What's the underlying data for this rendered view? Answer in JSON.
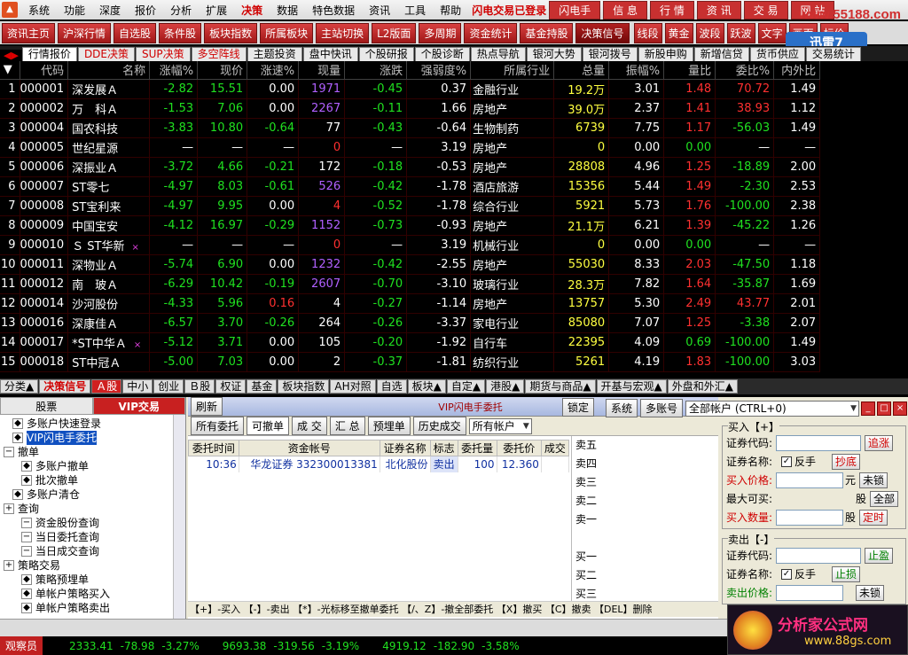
{
  "menubar": {
    "items": [
      "系统",
      "功能",
      "深度",
      "报价",
      "分析",
      "扩展",
      "决策",
      "数据",
      "特色数据",
      "资讯",
      "工具",
      "帮助"
    ],
    "active_index": 6,
    "status": "闪电交易已登录",
    "right_buttons": [
      "闪电手",
      "信 息",
      "行 情",
      "资 讯",
      "交 易",
      "网 站"
    ]
  },
  "watermark": "www.55188.com",
  "toolbar": {
    "buttons": [
      "资讯主页",
      "沪深行情",
      "自选股",
      "条件股",
      "板块指数",
      "所属板块",
      "主站切换",
      "L2版面",
      "多周期",
      "资金统计",
      "基金持股",
      "决策信号"
    ],
    "right_buttons": [
      "线段",
      "黄金",
      "波段",
      "跃波",
      "文字",
      "画面",
      "标价"
    ]
  },
  "xunlei": "迅雷7",
  "tabs": {
    "items": [
      "行情报价",
      "DDE决策",
      "SUP决策",
      "多空阵线",
      "主题投资",
      "盘中快讯",
      "个股研报",
      "个股诊断",
      "热点导航",
      "银河大势",
      "银河拨号",
      "新股申购",
      "新增信贷",
      "货币供应",
      "交易统计"
    ],
    "selected": 0,
    "red": [
      1,
      2,
      3
    ]
  },
  "grid": {
    "headers": [
      "",
      "代码",
      "名称",
      "涨幅%",
      "现价",
      "涨速%",
      "现量",
      "涨跌",
      "强弱度%",
      "所属行业",
      "总量",
      "振幅%",
      "量比",
      "委比%",
      "内外比"
    ],
    "rows": [
      {
        "n": "1",
        "code": "000001",
        "name": "深发展Ａ",
        "mark": "",
        "chg": "-2.82",
        "price": "15.51",
        "speed": "0.00",
        "vol": "1971",
        "diff": "-0.45",
        "str": "0.37",
        "ind": "金融行业",
        "total": "19.2万",
        "amp": "3.01",
        "vr": "1.48",
        "wb": "70.72",
        "io": "1.49",
        "c": {
          "chg": "g",
          "price": "g",
          "speed": "w",
          "vol": "p",
          "diff": "g",
          "total": "y",
          "vr": "r",
          "wb": "r"
        }
      },
      {
        "n": "2",
        "code": "000002",
        "name": "万　科Ａ",
        "mark": "",
        "chg": "-1.53",
        "price": "7.06",
        "speed": "0.00",
        "vol": "2267",
        "diff": "-0.11",
        "str": "1.66",
        "ind": "房地产",
        "total": "39.0万",
        "amp": "2.37",
        "vr": "1.41",
        "wb": "38.93",
        "io": "1.12",
        "c": {
          "chg": "g",
          "price": "g",
          "speed": "w",
          "vol": "p",
          "diff": "g",
          "total": "y",
          "vr": "r",
          "wb": "r"
        }
      },
      {
        "n": "3",
        "code": "000004",
        "name": "国农科技",
        "mark": "",
        "chg": "-3.83",
        "price": "10.80",
        "speed": "-0.64",
        "vol": "77",
        "diff": "-0.43",
        "str": "-0.64",
        "ind": "生物制药",
        "total": "6739",
        "amp": "7.75",
        "vr": "1.17",
        "wb": "-56.03",
        "io": "1.49",
        "c": {
          "chg": "g",
          "price": "g",
          "speed": "g",
          "vol": "w",
          "diff": "g",
          "total": "y",
          "vr": "r",
          "wb": "g"
        }
      },
      {
        "n": "4",
        "code": "000005",
        "name": "世纪星源",
        "mark": "",
        "chg": "—",
        "price": "—",
        "speed": "—",
        "vol": "0",
        "diff": "—",
        "str": "3.19",
        "ind": "房地产",
        "total": "0",
        "amp": "0.00",
        "vr": "0.00",
        "wb": "—",
        "io": "—",
        "c": {
          "chg": "w",
          "price": "w",
          "speed": "w",
          "vol": "r",
          "diff": "w",
          "total": "y",
          "vr": "g",
          "wb": "w"
        }
      },
      {
        "n": "5",
        "code": "000006",
        "name": "深振业Ａ",
        "mark": "",
        "chg": "-3.72",
        "price": "4.66",
        "speed": "-0.21",
        "vol": "172",
        "diff": "-0.18",
        "str": "-0.53",
        "ind": "房地产",
        "total": "28808",
        "amp": "4.96",
        "vr": "1.25",
        "wb": "-18.89",
        "io": "2.00",
        "c": {
          "chg": "g",
          "price": "g",
          "speed": "g",
          "vol": "w",
          "diff": "g",
          "total": "y",
          "vr": "r",
          "wb": "g"
        }
      },
      {
        "n": "6",
        "code": "000007",
        "name": "ST零七",
        "mark": "",
        "chg": "-4.97",
        "price": "8.03",
        "speed": "-0.61",
        "vol": "526",
        "diff": "-0.42",
        "str": "-1.78",
        "ind": "酒店旅游",
        "total": "15356",
        "amp": "5.44",
        "vr": "1.49",
        "wb": "-2.30",
        "io": "2.53",
        "c": {
          "chg": "g",
          "price": "g",
          "speed": "g",
          "vol": "p",
          "diff": "g",
          "total": "y",
          "vr": "r",
          "wb": "g"
        }
      },
      {
        "n": "7",
        "code": "000008",
        "name": "ST宝利来",
        "mark": "",
        "chg": "-4.97",
        "price": "9.95",
        "speed": "0.00",
        "vol": "4",
        "diff": "-0.52",
        "str": "-1.78",
        "ind": "综合行业",
        "total": "5921",
        "amp": "5.73",
        "vr": "1.76",
        "wb": "-100.00",
        "io": "2.38",
        "c": {
          "chg": "g",
          "price": "g",
          "speed": "w",
          "vol": "r",
          "diff": "g",
          "total": "y",
          "vr": "r",
          "wb": "g"
        }
      },
      {
        "n": "8",
        "code": "000009",
        "name": "中国宝安",
        "mark": "",
        "chg": "-4.12",
        "price": "16.97",
        "speed": "-0.29",
        "vol": "1152",
        "diff": "-0.73",
        "str": "-0.93",
        "ind": "房地产",
        "total": "21.1万",
        "amp": "6.21",
        "vr": "1.39",
        "wb": "-45.22",
        "io": "1.26",
        "c": {
          "chg": "g",
          "price": "g",
          "speed": "g",
          "vol": "p",
          "diff": "g",
          "total": "y",
          "vr": "r",
          "wb": "g"
        }
      },
      {
        "n": "9",
        "code": "000010",
        "name": "Ｓ ST华新",
        "mark": "×",
        "chg": "—",
        "price": "—",
        "speed": "—",
        "vol": "0",
        "diff": "—",
        "str": "3.19",
        "ind": "机械行业",
        "total": "0",
        "amp": "0.00",
        "vr": "0.00",
        "wb": "—",
        "io": "—",
        "c": {
          "chg": "w",
          "price": "w",
          "speed": "w",
          "vol": "r",
          "diff": "w",
          "total": "y",
          "vr": "g",
          "wb": "w"
        }
      },
      {
        "n": "10",
        "code": "000011",
        "name": "深物业Ａ",
        "mark": "",
        "chg": "-5.74",
        "price": "6.90",
        "speed": "0.00",
        "vol": "1232",
        "diff": "-0.42",
        "str": "-2.55",
        "ind": "房地产",
        "total": "55030",
        "amp": "8.33",
        "vr": "2.03",
        "wb": "-47.50",
        "io": "1.18",
        "c": {
          "chg": "g",
          "price": "g",
          "speed": "w",
          "vol": "p",
          "diff": "g",
          "total": "y",
          "vr": "r",
          "wb": "g"
        }
      },
      {
        "n": "11",
        "code": "000012",
        "name": "南　玻Ａ",
        "mark": "",
        "chg": "-6.29",
        "price": "10.42",
        "speed": "-0.19",
        "vol": "2607",
        "diff": "-0.70",
        "str": "-3.10",
        "ind": "玻璃行业",
        "total": "28.3万",
        "amp": "7.82",
        "vr": "1.64",
        "wb": "-35.87",
        "io": "1.69",
        "c": {
          "chg": "g",
          "price": "g",
          "speed": "g",
          "vol": "p",
          "diff": "g",
          "total": "y",
          "vr": "r",
          "wb": "g"
        }
      },
      {
        "n": "12",
        "code": "000014",
        "name": "沙河股份",
        "mark": "",
        "chg": "-4.33",
        "price": "5.96",
        "speed": "0.16",
        "vol": "4",
        "diff": "-0.27",
        "str": "-1.14",
        "ind": "房地产",
        "total": "13757",
        "amp": "5.30",
        "vr": "2.49",
        "wb": "43.77",
        "io": "2.01",
        "c": {
          "chg": "g",
          "price": "g",
          "speed": "r",
          "vol": "w",
          "diff": "g",
          "total": "y",
          "vr": "r",
          "wb": "r"
        }
      },
      {
        "n": "13",
        "code": "000016",
        "name": "深康佳Ａ",
        "mark": "",
        "chg": "-6.57",
        "price": "3.70",
        "speed": "-0.26",
        "vol": "264",
        "diff": "-0.26",
        "str": "-3.37",
        "ind": "家电行业",
        "total": "85080",
        "amp": "7.07",
        "vr": "1.25",
        "wb": "-3.38",
        "io": "2.07",
        "c": {
          "chg": "g",
          "price": "g",
          "speed": "g",
          "vol": "w",
          "diff": "g",
          "total": "y",
          "vr": "r",
          "wb": "g"
        }
      },
      {
        "n": "14",
        "code": "000017",
        "name": "*ST中华Ａ",
        "mark": "×",
        "chg": "-5.12",
        "price": "3.71",
        "speed": "0.00",
        "vol": "105",
        "diff": "-0.20",
        "str": "-1.92",
        "ind": "自行车",
        "total": "22395",
        "amp": "4.09",
        "vr": "0.69",
        "wb": "-100.00",
        "io": "1.49",
        "c": {
          "chg": "g",
          "price": "g",
          "speed": "w",
          "vol": "w",
          "diff": "g",
          "total": "y",
          "vr": "g",
          "wb": "g"
        }
      },
      {
        "n": "15",
        "code": "000018",
        "name": "ST中冠Ａ",
        "mark": "",
        "chg": "-5.00",
        "price": "7.03",
        "speed": "0.00",
        "vol": "2",
        "diff": "-0.37",
        "str": "-1.81",
        "ind": "纺织行业",
        "total": "5261",
        "amp": "4.19",
        "vr": "1.83",
        "wb": "-100.00",
        "io": "3.03",
        "c": {
          "chg": "g",
          "price": "g",
          "speed": "w",
          "vol": "w",
          "diff": "g",
          "total": "y",
          "vr": "r",
          "wb": "g"
        }
      }
    ]
  },
  "btabs": {
    "items": [
      "分类▲",
      "决策信号",
      "Ａ股",
      "中小",
      "创业",
      "Ｂ股",
      "权证",
      "基金",
      "板块指数",
      "AH对照",
      "自选",
      "板块▲",
      "自定▲",
      "港股▲",
      "期货与商品▲",
      "开基与宏观▲",
      "外盘和外汇▲"
    ],
    "active": 2,
    "red": 1
  },
  "lower": {
    "left_tabs": [
      "股票",
      "VIP交易"
    ],
    "left_selected": 1,
    "tree": [
      {
        "label": "多账户快速登录",
        "indent": 1,
        "icon": "◆",
        "sel": false
      },
      {
        "label": "VIP闪电手委托",
        "indent": 1,
        "icon": "◆",
        "sel": true
      },
      {
        "label": "撤单",
        "indent": 0,
        "icon": "−",
        "sel": false
      },
      {
        "label": "多账户撤单",
        "indent": 2,
        "icon": "◆",
        "sel": false
      },
      {
        "label": "批次撤单",
        "indent": 2,
        "icon": "◆",
        "sel": false
      },
      {
        "label": "多账户清仓",
        "indent": 1,
        "icon": "◆",
        "sel": false
      },
      {
        "label": "查询",
        "indent": 0,
        "icon": "+",
        "sel": false
      },
      {
        "label": "资金股份查询",
        "indent": 2,
        "icon": "−",
        "sel": false
      },
      {
        "label": "当日委托查询",
        "indent": 2,
        "icon": "−",
        "sel": false
      },
      {
        "label": "当日成交查询",
        "indent": 2,
        "icon": "−",
        "sel": false
      },
      {
        "label": "策略交易",
        "indent": 0,
        "icon": "+",
        "sel": false
      },
      {
        "label": "策略预埋单",
        "indent": 2,
        "icon": "◆",
        "sel": false
      },
      {
        "label": "单帐户策略买入",
        "indent": 2,
        "icon": "◆",
        "sel": false
      },
      {
        "label": "单帐户策略卖出",
        "indent": 2,
        "icon": "◆",
        "sel": false
      }
    ],
    "mid": {
      "refresh": "刷新",
      "title": "VIP闪电手委托",
      "lock": "锁定",
      "system": "系统",
      "multi": "多账号",
      "account_select": "全部帐户 (CTRL+0)",
      "sub_buttons": [
        "所有委托",
        "可撤单",
        "成 交",
        "汇 总",
        "预埋单",
        "历史成交"
      ],
      "sub_select": "所有帐户",
      "order_headers": [
        "委托时间",
        "资金帐号",
        "证券名称",
        "标志",
        "委托量",
        "委托价",
        "成交"
      ],
      "orders": [
        {
          "time": "10:36",
          "acct": "华龙证券 332300013381",
          "name": "北化股份",
          "flag": "卖出",
          "qty": "100",
          "price": "12.360",
          "deal": ""
        }
      ],
      "book": [
        "卖五",
        "卖四",
        "卖三",
        "卖二",
        "卖一",
        "",
        "买一",
        "买二",
        "买三"
      ],
      "help": "【+】-买入  【-】-卖出  【*】-光标移至撤单委托  【/、Z】-撤全部委托  【X】撤买  【C】撤卖  【DEL】删除"
    },
    "right": {
      "buy_legend": "买入【+】",
      "sell_legend": "卖出【-】",
      "buy_rows": [
        "证券代码:",
        "证券名称:",
        "买入价格:",
        "最大可买:",
        "买入数量:"
      ],
      "sell_rows": [
        "证券代码:",
        "证券名称:",
        "卖出价格:"
      ],
      "buttons": {
        "chase": "追涨",
        "dip": "抄底",
        "unlock": "未锁",
        "all": "全部",
        "timed": "定时",
        "stop_profit": "止盈",
        "stop_loss": "止损",
        "unlock2": "未锁"
      },
      "reverse": "反手",
      "yuan": "元",
      "gu": "股"
    }
  },
  "ticker": {
    "observer": "观察员",
    "indices": [
      {
        "v": "2333.41",
        "c": "-78.98",
        "p": "-3.27%"
      },
      {
        "v": "9693.38",
        "c": "-319.56",
        "p": "-3.19%"
      },
      {
        "v": "4919.12",
        "c": "-182.90",
        "p": "-3.58%"
      }
    ]
  },
  "brand": {
    "name": "分析家公式网",
    "url": "www.88gs.com"
  },
  "colors": {
    "up": "#ff3030",
    "down": "#20e020",
    "accent": "#c82020"
  }
}
